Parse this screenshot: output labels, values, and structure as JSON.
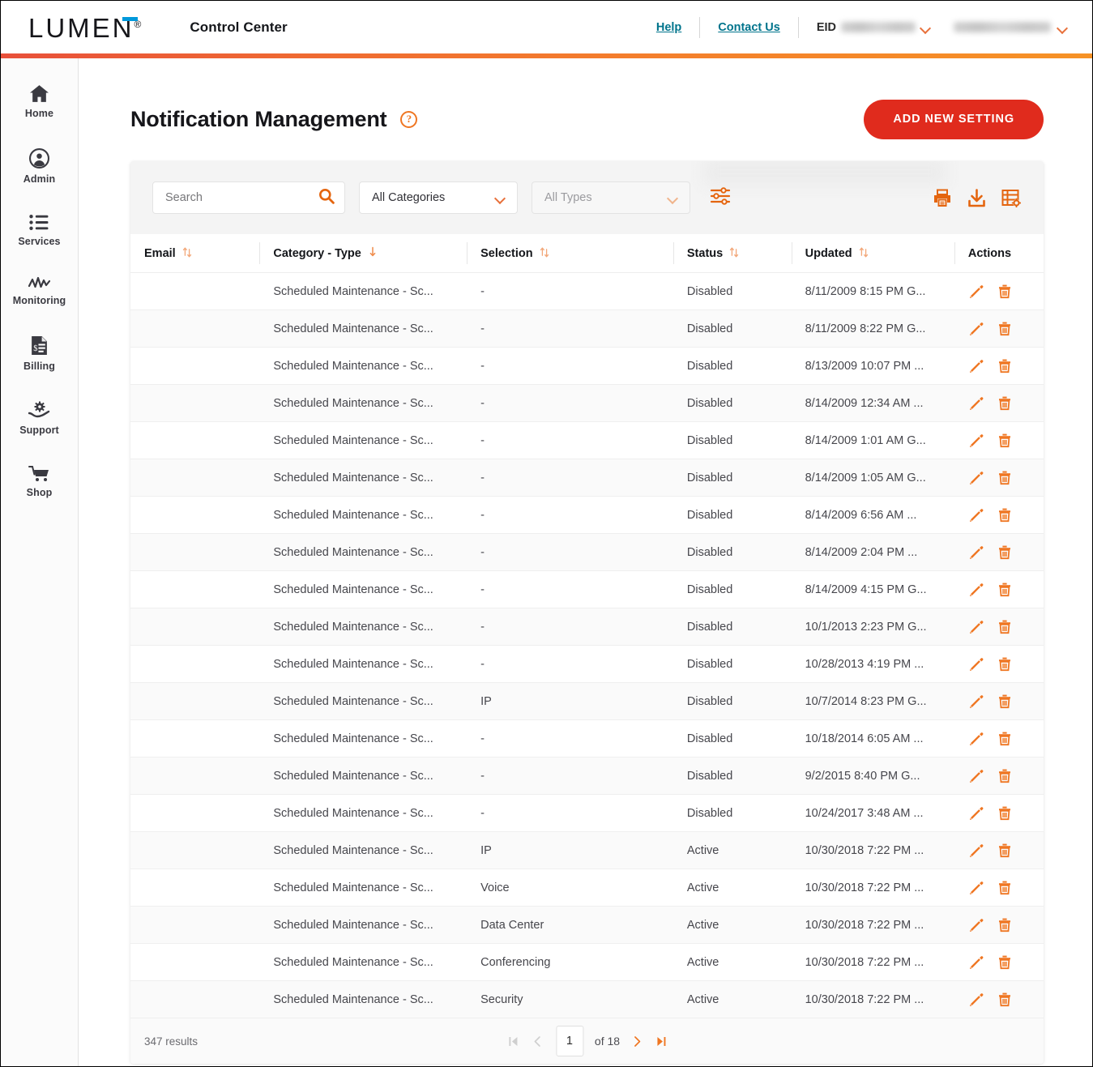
{
  "header": {
    "logo_text": "LUMEN",
    "logo_registered": "®",
    "app_title": "Control Center",
    "help_label": "Help",
    "contact_label": "Contact Us",
    "eid_label": "EID",
    "eid_value": "",
    "account_value": "",
    "accent_left_color": "#e8503a",
    "accent_right_color": "#f69226",
    "link_color": "#00748c"
  },
  "sidebar": {
    "items": [
      {
        "label": "Home",
        "icon": "home-icon"
      },
      {
        "label": "Admin",
        "icon": "user-circle-icon"
      },
      {
        "label": "Services",
        "icon": "list-icon"
      },
      {
        "label": "Monitoring",
        "icon": "chart-line-icon"
      },
      {
        "label": "Billing",
        "icon": "invoice-icon"
      },
      {
        "label": "Support",
        "icon": "hand-gear-icon"
      },
      {
        "label": "Shop",
        "icon": "cart-icon"
      }
    ]
  },
  "page": {
    "title": "Notification Management",
    "help_icon_glyph": "?",
    "add_button_label": "ADD NEW SETTING",
    "add_button_color": "#e02b1d"
  },
  "filters": {
    "search_placeholder": "Search",
    "search_value": "",
    "search_icon": "search-icon",
    "category_select": "All Categories",
    "type_select": "All Types",
    "filter_icon": "sliders-icon",
    "tools": [
      {
        "name": "print-icon"
      },
      {
        "name": "download-icon"
      },
      {
        "name": "table-settings-icon"
      }
    ],
    "accent_color": "#e4650f"
  },
  "table": {
    "columns": [
      {
        "label": "Email",
        "sort": "both"
      },
      {
        "label": "Category - Type",
        "sort": "desc-active"
      },
      {
        "label": "Selection",
        "sort": "both"
      },
      {
        "label": "Status",
        "sort": "both"
      },
      {
        "label": "Updated",
        "sort": "both"
      },
      {
        "label": "Actions",
        "sort": "none"
      }
    ],
    "rows": [
      {
        "email": "",
        "category": "Scheduled Maintenance - Sc...",
        "selection": "-",
        "status": "Disabled",
        "updated": "8/11/2009 8:15 PM G..."
      },
      {
        "email": "",
        "category": "Scheduled Maintenance - Sc...",
        "selection": "-",
        "status": "Disabled",
        "updated": "8/11/2009 8:22 PM G..."
      },
      {
        "email": "",
        "category": "Scheduled Maintenance - Sc...",
        "selection": "-",
        "status": "Disabled",
        "updated": "8/13/2009 10:07 PM ..."
      },
      {
        "email": "",
        "category": "Scheduled Maintenance - Sc...",
        "selection": "-",
        "status": "Disabled",
        "updated": "8/14/2009 12:34 AM ..."
      },
      {
        "email": "",
        "category": "Scheduled Maintenance - Sc...",
        "selection": "-",
        "status": "Disabled",
        "updated": "8/14/2009 1:01 AM G..."
      },
      {
        "email": "",
        "category": "Scheduled Maintenance - Sc...",
        "selection": "-",
        "status": "Disabled",
        "updated": "8/14/2009 1:05 AM G..."
      },
      {
        "email": "",
        "category": "Scheduled Maintenance - Sc...",
        "selection": "-",
        "status": "Disabled",
        "updated": "8/14/2009 6:56 AM ..."
      },
      {
        "email": "",
        "category": "Scheduled Maintenance - Sc...",
        "selection": "-",
        "status": "Disabled",
        "updated": "8/14/2009 2:04 PM ..."
      },
      {
        "email": "",
        "category": "Scheduled Maintenance - Sc...",
        "selection": "-",
        "status": "Disabled",
        "updated": "8/14/2009 4:15 PM G..."
      },
      {
        "email": "",
        "category": "Scheduled Maintenance - Sc...",
        "selection": "-",
        "status": "Disabled",
        "updated": "10/1/2013 2:23 PM G..."
      },
      {
        "email": "",
        "category": "Scheduled Maintenance - Sc...",
        "selection": "-",
        "status": "Disabled",
        "updated": "10/28/2013 4:19 PM ..."
      },
      {
        "email": "",
        "category": "Scheduled Maintenance - Sc...",
        "selection": "IP",
        "status": "Disabled",
        "updated": "10/7/2014 8:23 PM G..."
      },
      {
        "email": "",
        "category": "Scheduled Maintenance - Sc...",
        "selection": "-",
        "status": "Disabled",
        "updated": "10/18/2014 6:05 AM ..."
      },
      {
        "email": "",
        "category": "Scheduled Maintenance - Sc...",
        "selection": "-",
        "status": "Disabled",
        "updated": "9/2/2015 8:40 PM G..."
      },
      {
        "email": "",
        "category": "Scheduled Maintenance - Sc...",
        "selection": "-",
        "status": "Disabled",
        "updated": "10/24/2017 3:48 AM ..."
      },
      {
        "email": "",
        "category": "Scheduled Maintenance - Sc...",
        "selection": "IP",
        "status": "Active",
        "updated": "10/30/2018 7:22 PM ..."
      },
      {
        "email": "",
        "category": "Scheduled Maintenance - Sc...",
        "selection": "Voice",
        "status": "Active",
        "updated": "10/30/2018 7:22 PM ..."
      },
      {
        "email": "",
        "category": "Scheduled Maintenance - Sc...",
        "selection": "Data Center",
        "status": "Active",
        "updated": "10/30/2018 7:22 PM ..."
      },
      {
        "email": "",
        "category": "Scheduled Maintenance - Sc...",
        "selection": "Conferencing",
        "status": "Active",
        "updated": "10/30/2018 7:22 PM ..."
      },
      {
        "email": "",
        "category": "Scheduled Maintenance - Sc...",
        "selection": "Security",
        "status": "Active",
        "updated": "10/30/2018 7:22 PM ..."
      }
    ],
    "row_actions": {
      "edit_icon": "edit-pencil-icon",
      "delete_icon": "trash-icon"
    }
  },
  "footer": {
    "results_text": "347 results",
    "page_value": "1",
    "of_label": "of",
    "total_pages": "18",
    "first_icon": "first-page-icon",
    "prev_icon": "prev-page-icon",
    "next_icon": "next-page-icon",
    "last_icon": "last-page-icon"
  }
}
